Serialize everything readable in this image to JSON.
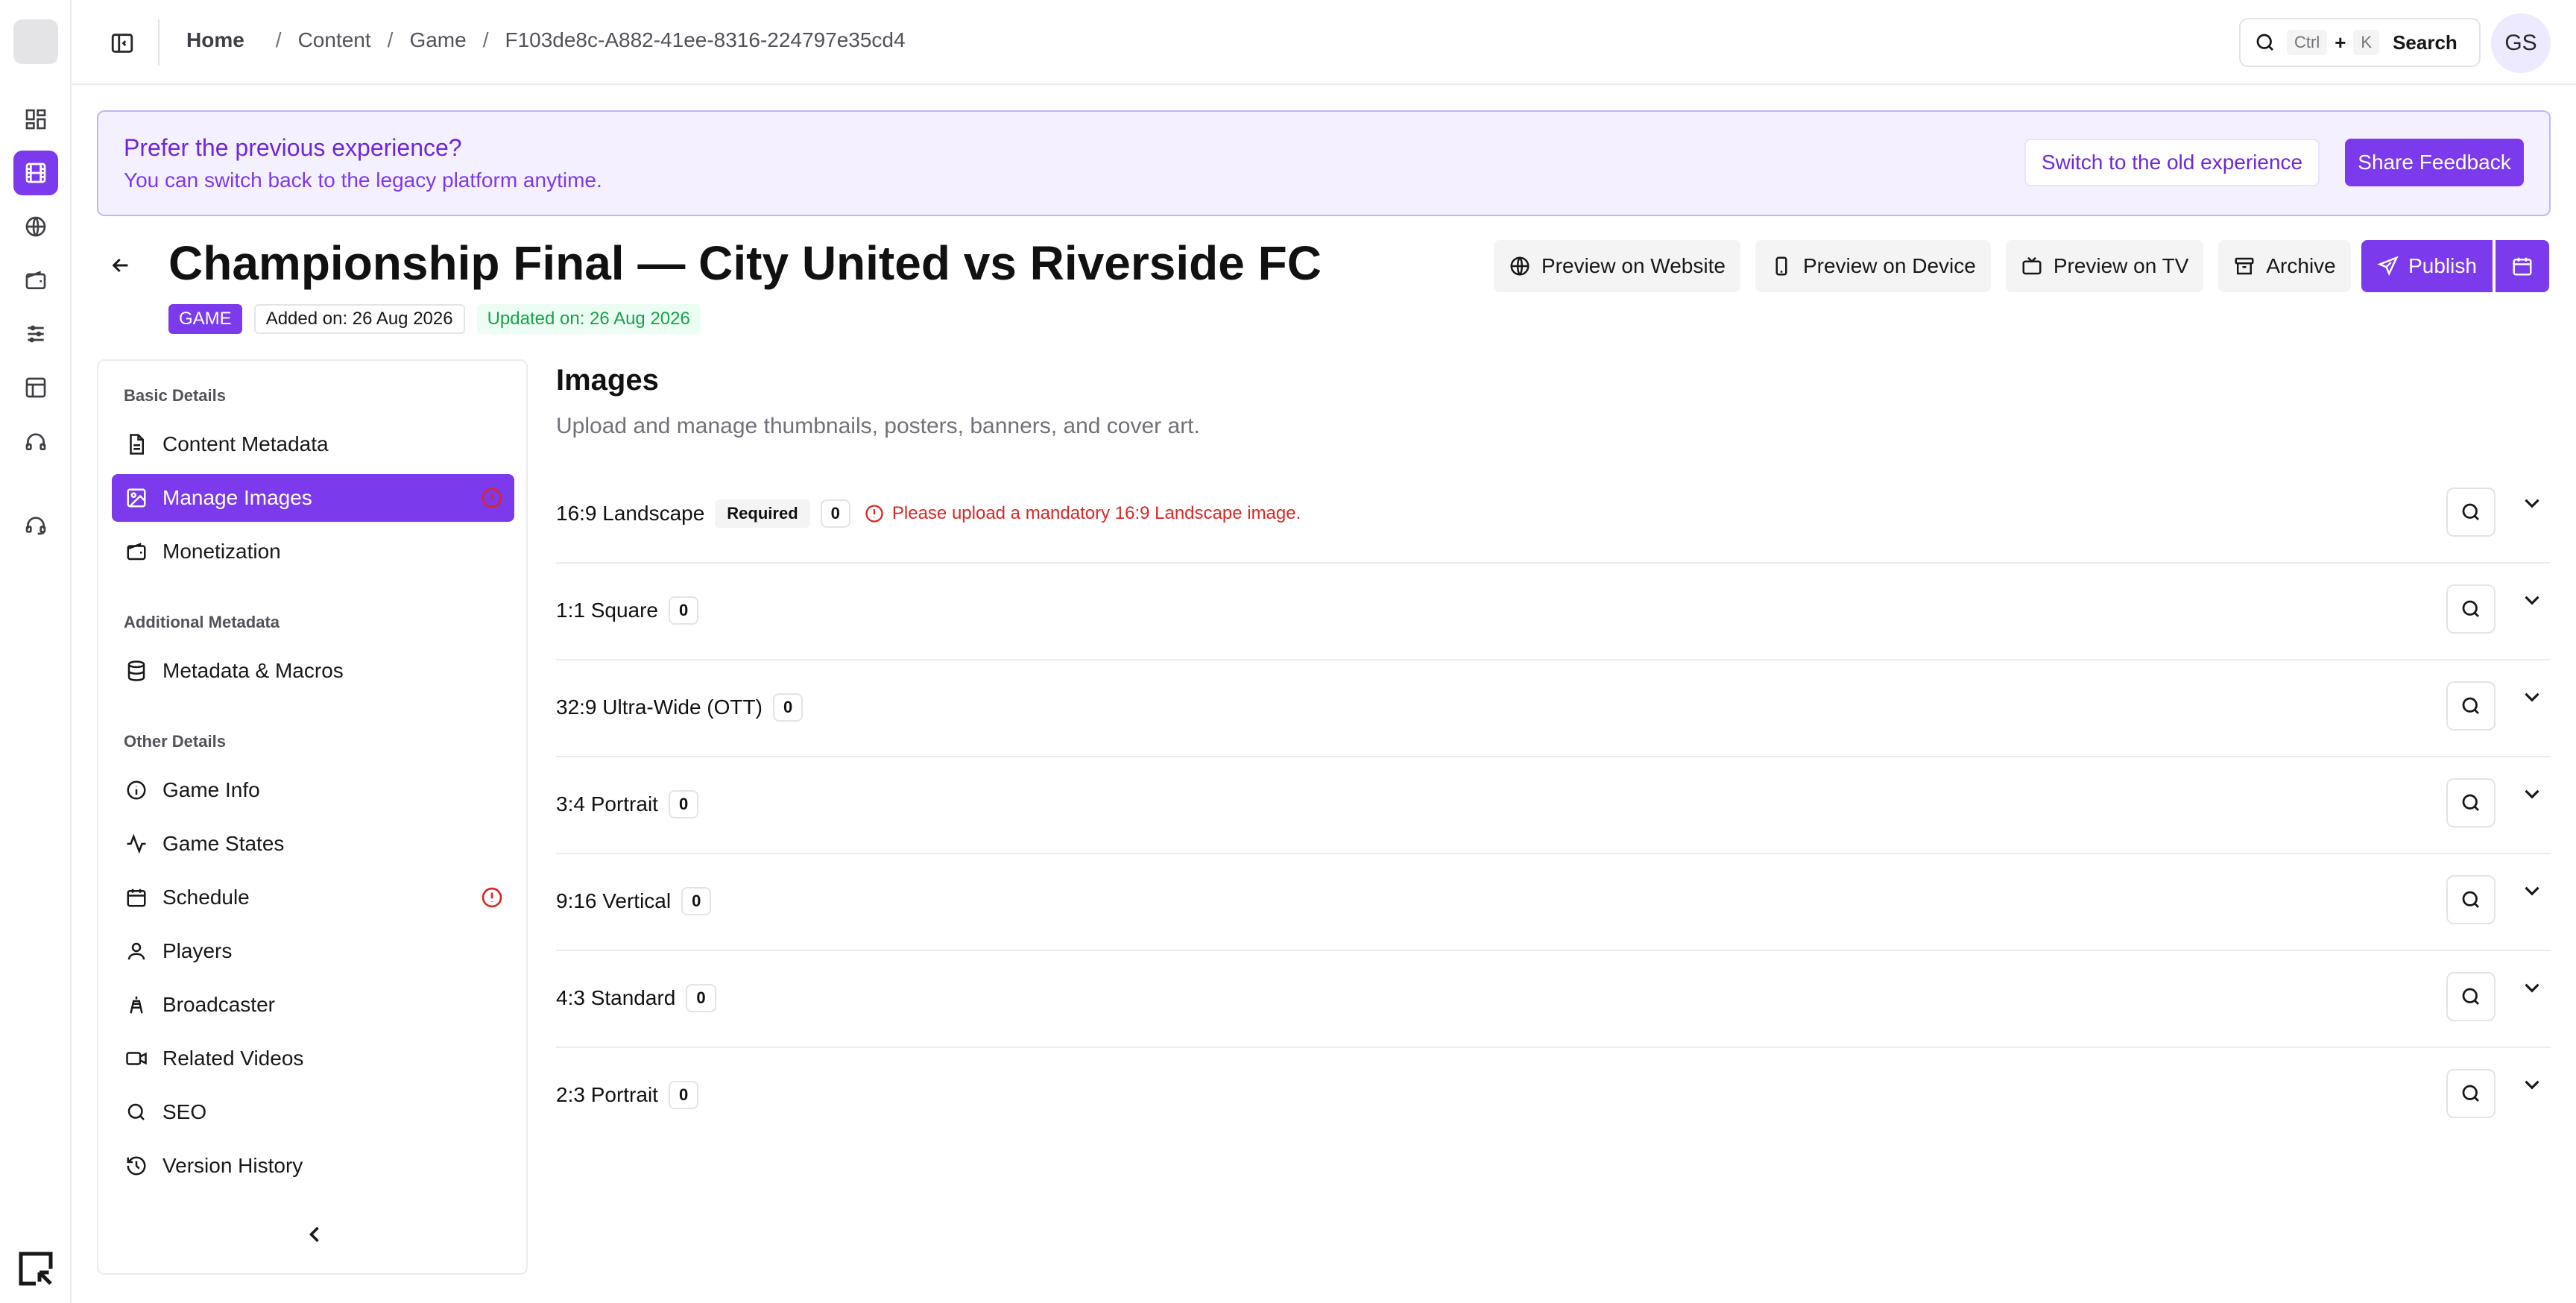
{
  "header": {
    "breadcrumb": [
      "Home",
      "Content",
      "Game",
      "F103de8c-A882-41ee-8316-224797e35cd4"
    ],
    "search": {
      "key1": "Ctrl",
      "plus": "+",
      "key2": "K",
      "label": "Search"
    },
    "avatar_initials": "GS"
  },
  "banner": {
    "title": "Prefer the previous experience?",
    "subtitle": "You can switch back to the legacy platform anytime.",
    "switch_label": "Switch to the old experience",
    "feedback_label": "Share Feedback"
  },
  "page": {
    "title": "Championship Final — City United vs Riverside FC",
    "type_badge": "GAME",
    "added": "Added on: 26 Aug 2026",
    "updated": "Updated on: 26 Aug 2026"
  },
  "actions": {
    "preview_website": "Preview on Website",
    "preview_device": "Preview on Device",
    "preview_tv": "Preview on TV",
    "archive": "Archive",
    "publish": "Publish"
  },
  "sidebar": {
    "sections": [
      "Basic Details",
      "Additional Metadata",
      "Other Details"
    ],
    "items": [
      {
        "label": "Content Metadata",
        "icon": "file-text-icon"
      },
      {
        "label": "Manage Images",
        "icon": "image-icon",
        "active": true,
        "alert": true
      },
      {
        "label": "Monetization",
        "icon": "wallet-icon"
      },
      {
        "label": "Metadata & Macros",
        "icon": "database-icon"
      },
      {
        "label": "Game Info",
        "icon": "info-icon"
      },
      {
        "label": "Game States",
        "icon": "activity-icon"
      },
      {
        "label": "Schedule",
        "icon": "calendar-icon",
        "alert": true
      },
      {
        "label": "Players",
        "icon": "user-icon"
      },
      {
        "label": "Broadcaster",
        "icon": "tower-icon"
      },
      {
        "label": "Related Videos",
        "icon": "video-icon"
      },
      {
        "label": "SEO",
        "icon": "search-icon"
      },
      {
        "label": "Version History",
        "icon": "history-icon"
      }
    ]
  },
  "main": {
    "title": "Images",
    "subtitle": "Upload and manage thumbnails, posters, banners, and cover art.",
    "required_label": "Required",
    "error_text": "Please upload a mandatory 16:9 Landscape image.",
    "rows": [
      {
        "label": "16:9 Landscape",
        "count": "0"
      },
      {
        "label": "1:1 Square",
        "count": "0"
      },
      {
        "label": "32:9 Ultra-Wide (OTT)",
        "count": "0"
      },
      {
        "label": "3:4 Portrait",
        "count": "0"
      },
      {
        "label": "9:16 Vertical",
        "count": "0"
      },
      {
        "label": "4:3 Standard",
        "count": "0"
      },
      {
        "label": "2:3 Portrait",
        "count": "0"
      }
    ]
  },
  "colors": {
    "accent": "#7c3aed",
    "error": "#dc2626",
    "success": "#16a34a"
  }
}
